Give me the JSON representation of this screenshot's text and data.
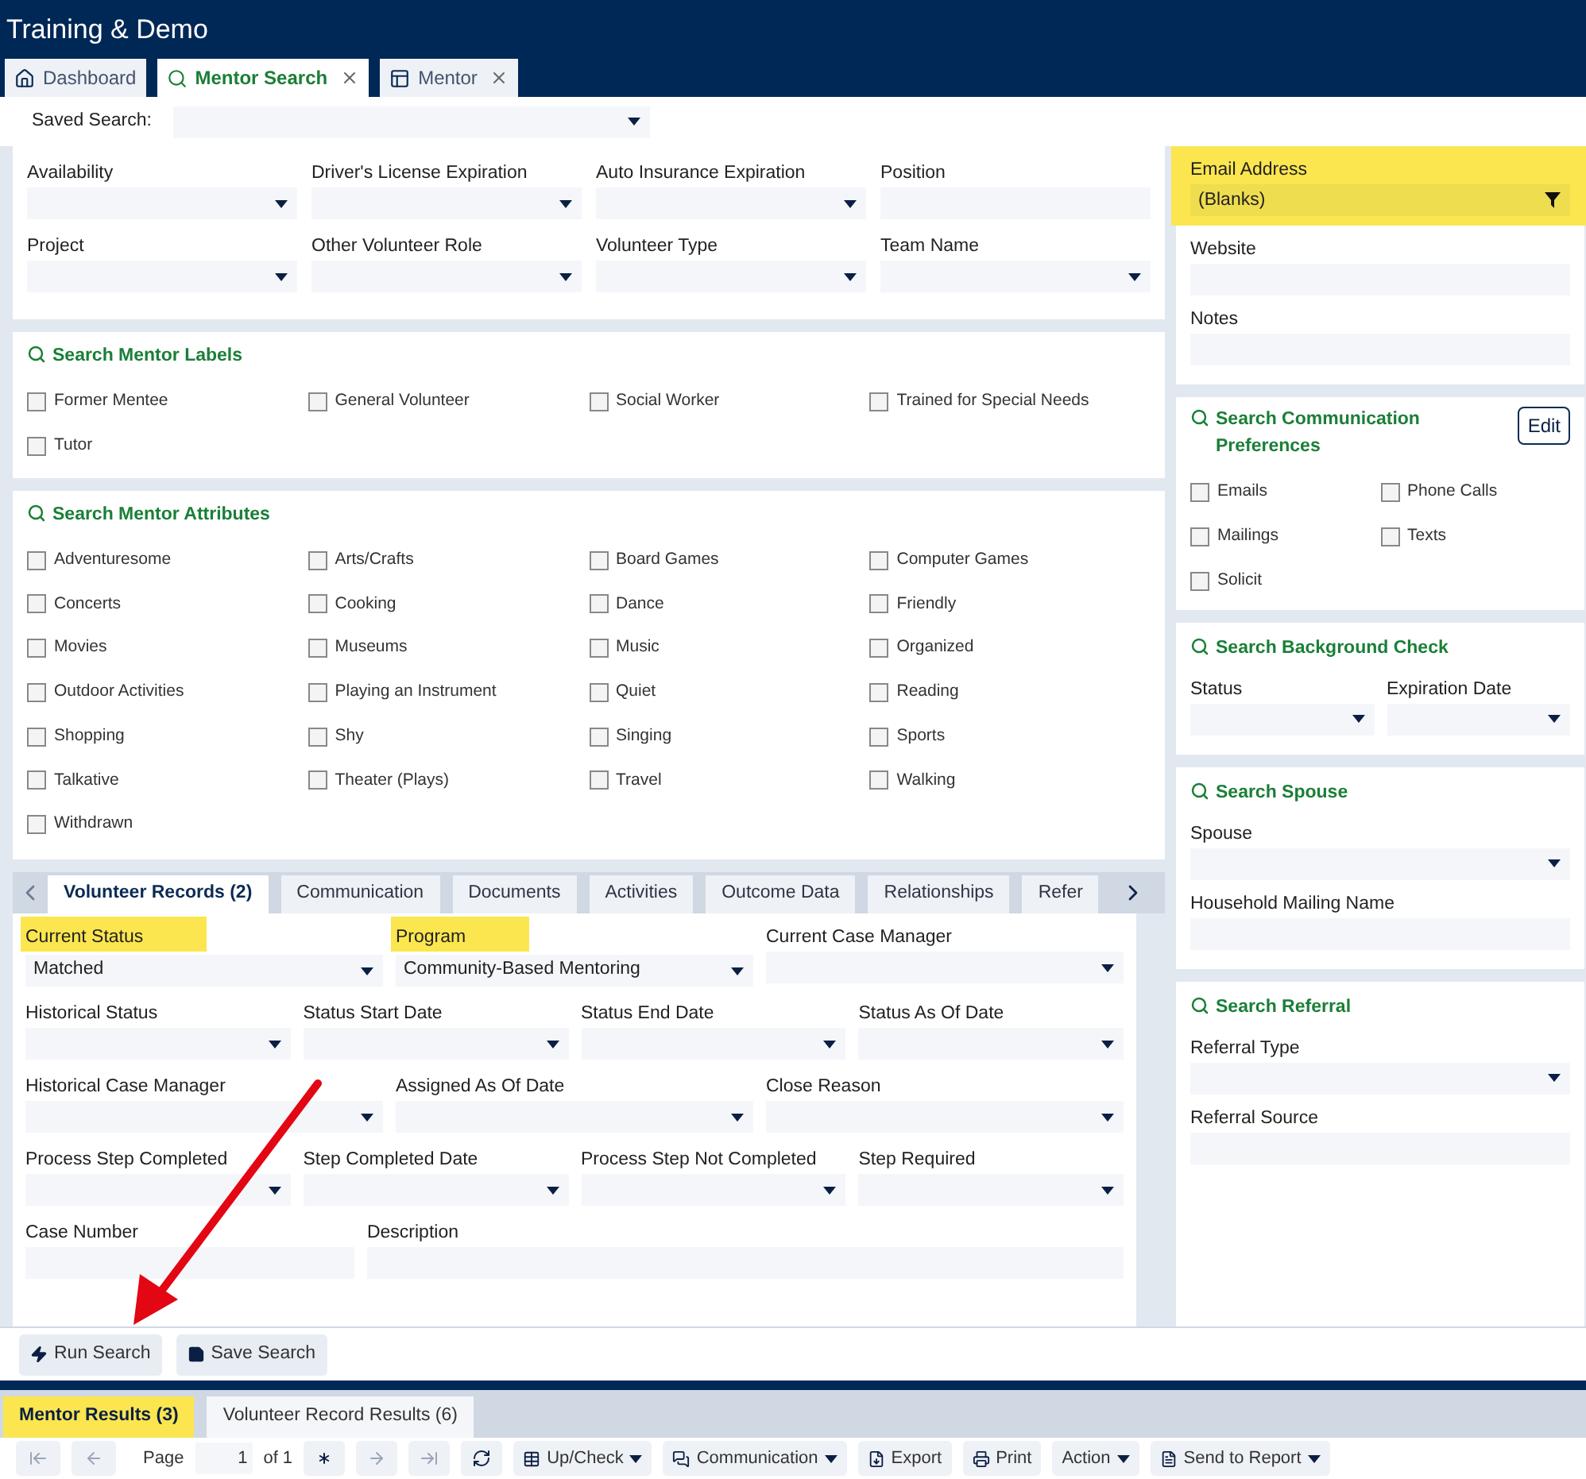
{
  "app": {
    "title": "Training & Demo"
  },
  "tabs": [
    {
      "label": "Dashboard",
      "selected": false,
      "closable": false
    },
    {
      "label": "Mentor Search",
      "selected": true,
      "closable": true
    },
    {
      "label": "Mentor",
      "selected": false,
      "closable": true
    }
  ],
  "saved_search": {
    "label": "Saved Search:"
  },
  "filters": [
    {
      "label": "Availability",
      "kind": "select"
    },
    {
      "label": "Driver's License Expiration",
      "kind": "select"
    },
    {
      "label": "Auto Insurance Expiration",
      "kind": "select"
    },
    {
      "label": "Position",
      "kind": "text"
    },
    {
      "label": "Project",
      "kind": "select"
    },
    {
      "label": "Other Volunteer Role",
      "kind": "select"
    },
    {
      "label": "Volunteer Type",
      "kind": "select"
    },
    {
      "label": "Team Name",
      "kind": "select"
    }
  ],
  "labels_section": {
    "title": "Search Mentor Labels",
    "items": [
      {
        "label": "Former Mentee",
        "checked": false
      },
      {
        "label": "General Volunteer",
        "checked": false
      },
      {
        "label": "Social Worker",
        "checked": false
      },
      {
        "label": "Trained for Special Needs",
        "checked": false
      },
      {
        "label": "Tutor",
        "checked": false
      }
    ]
  },
  "attributes_section": {
    "title": "Search Mentor Attributes",
    "items": [
      {
        "label": "Adventuresome",
        "checked": false
      },
      {
        "label": "Arts/Crafts",
        "checked": false
      },
      {
        "label": "Board Games",
        "checked": false
      },
      {
        "label": "Computer Games",
        "checked": false
      },
      {
        "label": "Concerts",
        "checked": false
      },
      {
        "label": "Cooking",
        "checked": false
      },
      {
        "label": "Dance",
        "checked": false
      },
      {
        "label": "Friendly",
        "checked": false
      },
      {
        "label": "Movies",
        "checked": false
      },
      {
        "label": "Museums",
        "checked": false
      },
      {
        "label": "Music",
        "checked": false
      },
      {
        "label": "Organized",
        "checked": false
      },
      {
        "label": "Outdoor Activities",
        "checked": false
      },
      {
        "label": "Playing an Instrument",
        "checked": false
      },
      {
        "label": "Quiet",
        "checked": false
      },
      {
        "label": "Reading",
        "checked": false
      },
      {
        "label": "Shopping",
        "checked": false
      },
      {
        "label": "Shy",
        "checked": false
      },
      {
        "label": "Singing",
        "checked": false
      },
      {
        "label": "Sports",
        "checked": false
      },
      {
        "label": "Talkative",
        "checked": false
      },
      {
        "label": "Theater (Plays)",
        "checked": false
      },
      {
        "label": "Travel",
        "checked": false
      },
      {
        "label": "Walking",
        "checked": false
      },
      {
        "label": "Withdrawn",
        "checked": false
      }
    ]
  },
  "records": {
    "tabs": [
      {
        "label": "Volunteer Records (2)",
        "selected": true
      },
      {
        "label": "Communication",
        "selected": false
      },
      {
        "label": "Documents",
        "selected": false
      },
      {
        "label": "Activities",
        "selected": false
      },
      {
        "label": "Outcome Data",
        "selected": false
      },
      {
        "label": "Relationships",
        "selected": false
      },
      {
        "label": "Refer",
        "selected": false
      }
    ],
    "rows": [
      [
        {
          "label": "Current Status",
          "kind": "select",
          "value": "Matched",
          "highlighted": true
        },
        {
          "label": "Program",
          "kind": "select",
          "value": "Community-Based Mentoring",
          "highlighted": true
        },
        {
          "label": "Current Case Manager",
          "kind": "select",
          "highlighted": false
        }
      ],
      [
        {
          "label": "Historical Status",
          "kind": "select",
          "highlighted": false
        },
        {
          "label": "Status Start Date",
          "kind": "select",
          "highlighted": false
        },
        {
          "label": "Status End Date",
          "kind": "select",
          "highlighted": false
        },
        {
          "label": "Status As Of Date",
          "kind": "select",
          "highlighted": false
        }
      ],
      [
        {
          "label": "Historical Case Manager",
          "kind": "select",
          "highlighted": false
        },
        {
          "label": "Assigned As Of Date",
          "kind": "select",
          "highlighted": false
        },
        {
          "label": "Close Reason",
          "kind": "select",
          "highlighted": false
        }
      ],
      [
        {
          "label": "Process Step Completed",
          "kind": "select",
          "highlighted": false
        },
        {
          "label": "Step Completed Date",
          "kind": "select",
          "highlighted": false
        },
        {
          "label": "Process Step Not Completed",
          "kind": "select",
          "highlighted": false
        },
        {
          "label": "Step Required",
          "kind": "select",
          "highlighted": false
        }
      ],
      [
        {
          "label": "Case Number",
          "kind": "text",
          "highlighted": false
        },
        {
          "label": "Description",
          "kind": "text",
          "highlighted": false
        }
      ]
    ]
  },
  "actions": [
    {
      "label": "Run Search"
    },
    {
      "label": "Save Search"
    }
  ],
  "results_tabs": [
    {
      "label": "Mentor Results (3)",
      "selected": true,
      "highlighted": true
    },
    {
      "label": "Volunteer Record Results (6)",
      "selected": false,
      "highlighted": false
    }
  ],
  "toolbar": {
    "page_label": "Page",
    "page_value": "1",
    "page_of": "of 1",
    "menus": [
      {
        "label": "Up/Check",
        "dropdown": true
      },
      {
        "label": "Communication",
        "dropdown": true
      },
      {
        "label": "Export",
        "dropdown": false
      },
      {
        "label": "Print",
        "dropdown": false
      },
      {
        "label": "Action",
        "dropdown": true
      },
      {
        "label": "Send to Report",
        "dropdown": true
      }
    ]
  },
  "email_section": {
    "fields": [
      {
        "label": "Email Address",
        "kind": "filter",
        "value": "(Blanks)",
        "highlighted": true
      },
      {
        "label": "Website",
        "kind": "text",
        "highlighted": false
      },
      {
        "label": "Notes",
        "kind": "text",
        "highlighted": false
      }
    ]
  },
  "communication_section": {
    "title": "Search Communication Preferences",
    "edit": "Edit",
    "items": [
      {
        "label": "Emails",
        "checked": false
      },
      {
        "label": "Phone Calls",
        "checked": false
      },
      {
        "label": "Mailings",
        "checked": false
      },
      {
        "label": "Texts",
        "checked": false
      },
      {
        "label": "Solicit",
        "checked": false
      }
    ]
  },
  "background_section": {
    "title": "Search Background Check",
    "fields": [
      {
        "label": "Status",
        "kind": "select"
      },
      {
        "label": "Expiration Date",
        "kind": "select"
      }
    ]
  },
  "spouse_section": {
    "title": "Search Spouse",
    "fields": [
      {
        "label": "Spouse",
        "kind": "select"
      },
      {
        "label": "Household Mailing Name",
        "kind": "text"
      }
    ]
  },
  "referral_section": {
    "title": "Search Referral",
    "fields": [
      {
        "label": "Referral Type",
        "kind": "select"
      },
      {
        "label": "Referral Source",
        "kind": "text"
      }
    ]
  }
}
